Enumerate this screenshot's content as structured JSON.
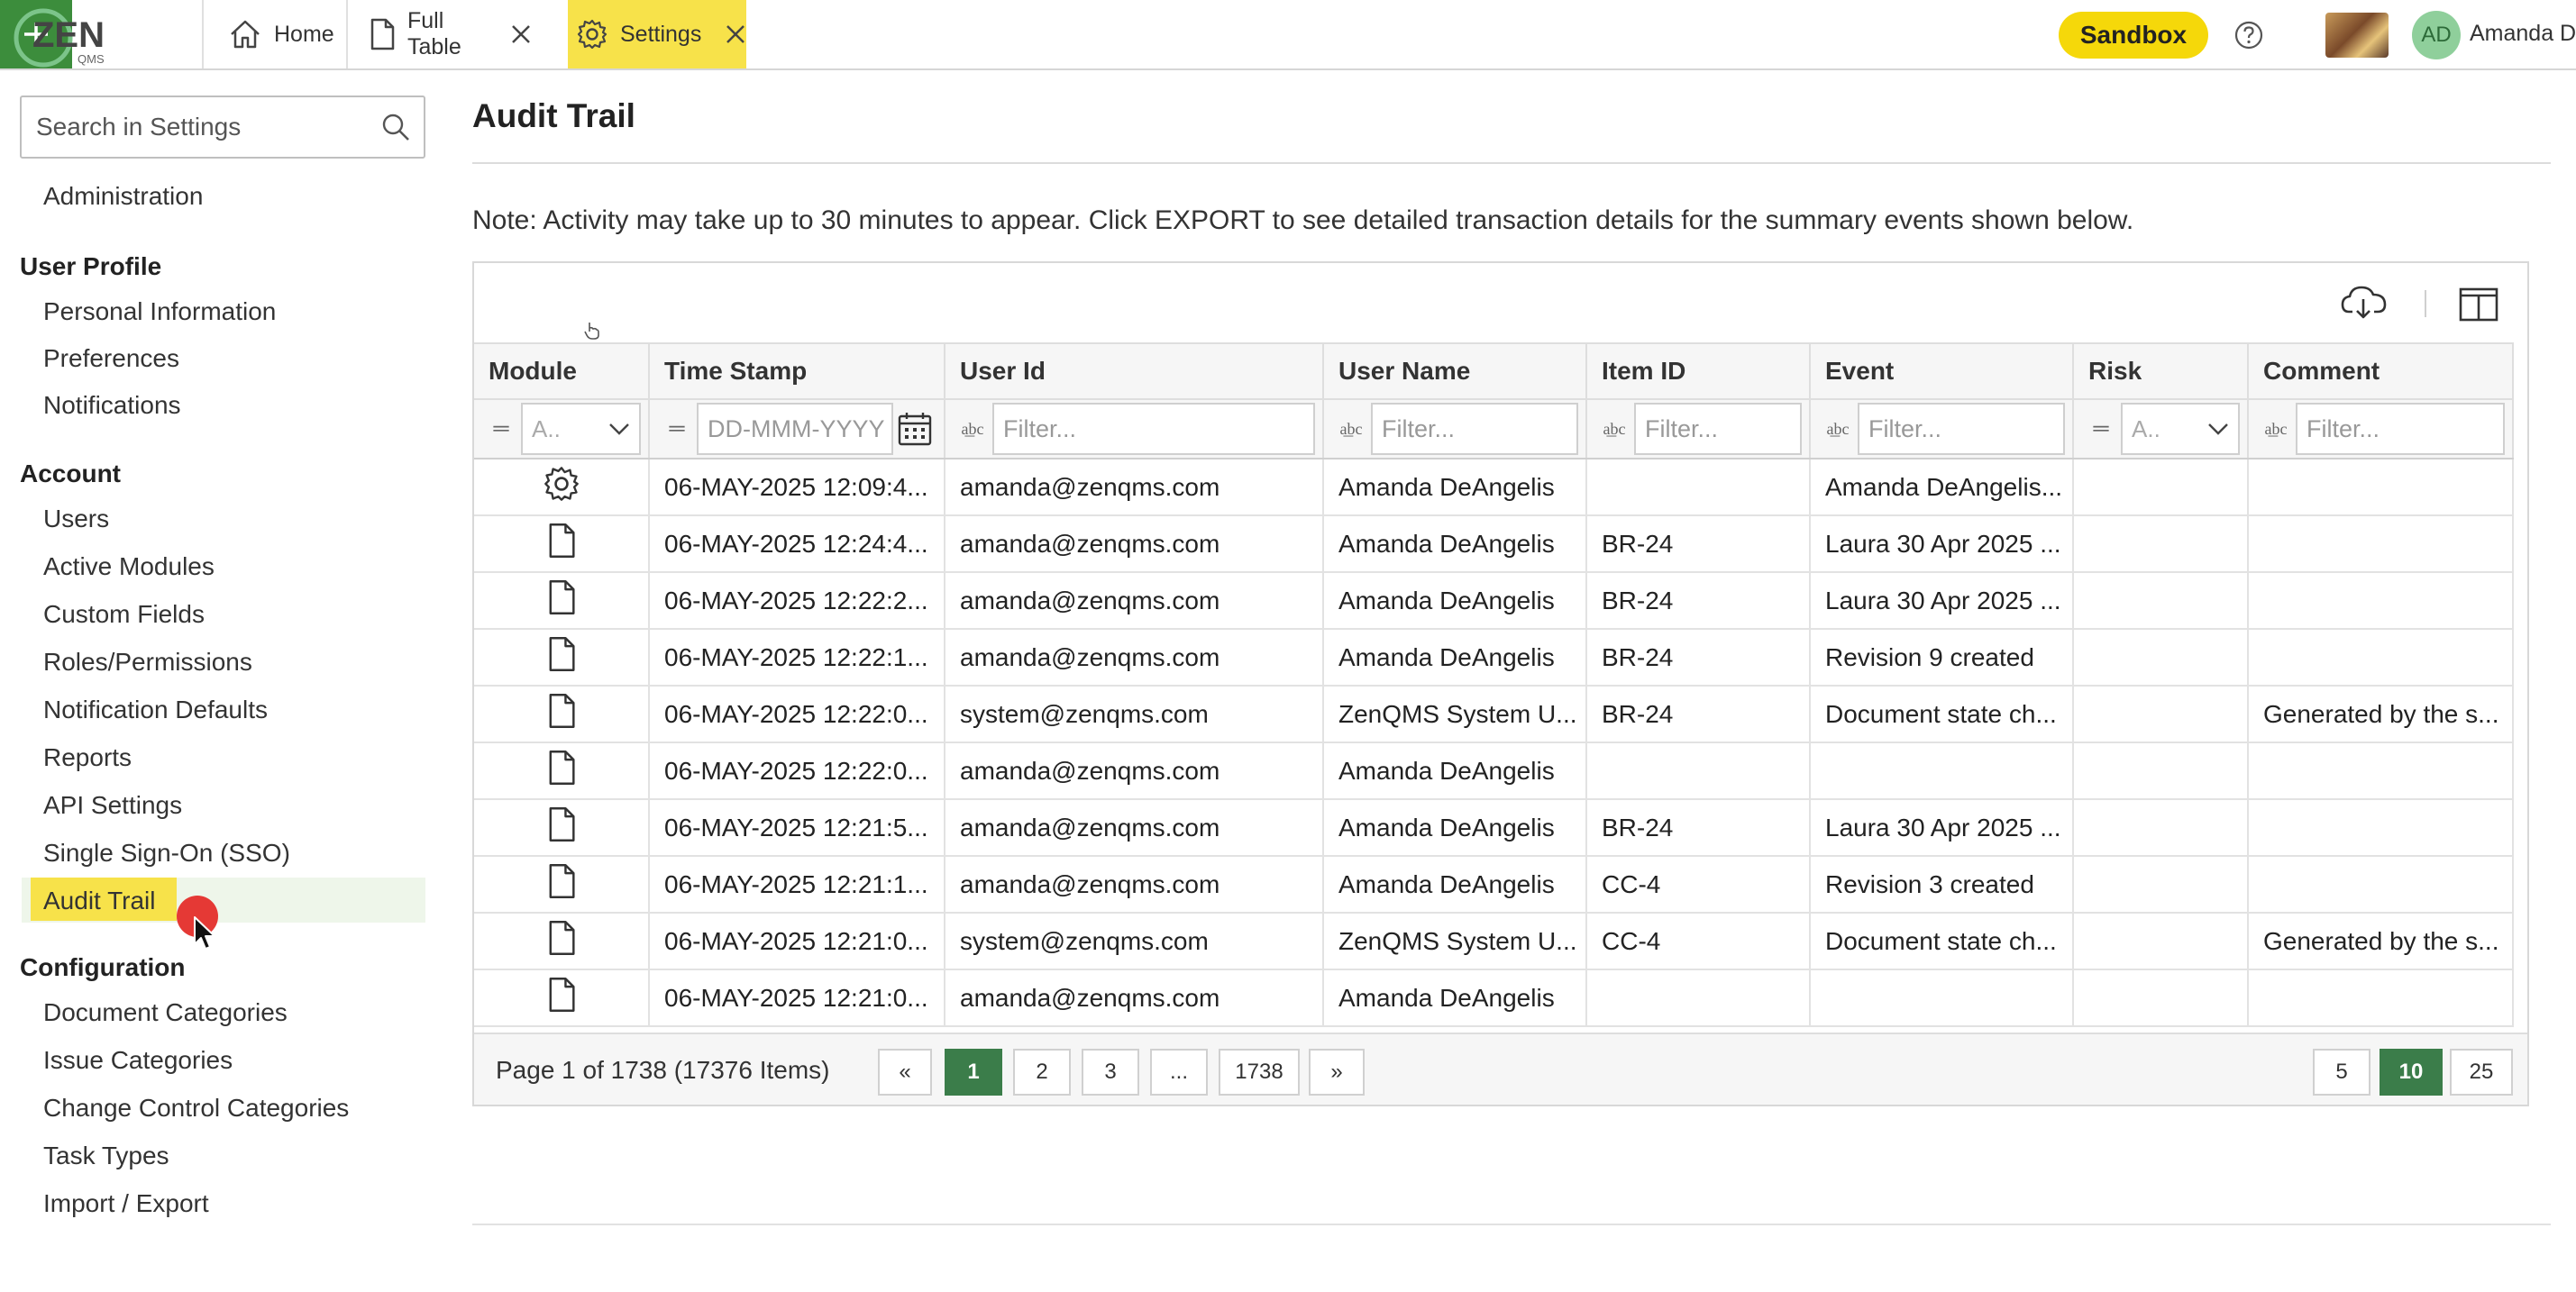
{
  "brand": {
    "logo_text": "ZEN",
    "logo_sub": "QMS"
  },
  "tabs": [
    {
      "label": "Home",
      "icon": "home-icon"
    },
    {
      "label": "Full Table",
      "icon": "document-icon"
    },
    {
      "label": "Settings",
      "icon": "gear-icon",
      "active": true
    }
  ],
  "header": {
    "sandbox_label": "Sandbox",
    "avatar_initials": "AD",
    "user_name": "Amanda D"
  },
  "sidebar": {
    "search_placeholder": "Search in Settings",
    "top_item": "Administration",
    "sections": [
      {
        "title": "User Profile",
        "items": [
          "Personal Information",
          "Preferences",
          "Notifications"
        ]
      },
      {
        "title": "Account",
        "items": [
          "Users",
          "Active Modules",
          "Custom Fields",
          "Roles/Permissions",
          "Notification Defaults",
          "Reports",
          "API Settings",
          "Single Sign-On (SSO)",
          "Audit Trail"
        ]
      },
      {
        "title": "Configuration",
        "items": [
          "Document Categories",
          "Issue Categories",
          "Change Control Categories",
          "Task Types",
          "Import / Export"
        ]
      }
    ],
    "active_item": "Audit Trail"
  },
  "main": {
    "title": "Audit Trail",
    "note": "Note: Activity may take up to 30 minutes to appear. Click EXPORT to see detailed transaction details for the summary events shown below."
  },
  "table": {
    "columns": [
      "Module",
      "Time Stamp",
      "User Id",
      "User Name",
      "Item ID",
      "Event",
      "Risk",
      "Comment"
    ],
    "filters": {
      "module": "A..",
      "timestamp": "DD-MMM-YYYY",
      "user_id": "Filter...",
      "user_name": "Filter...",
      "item_id": "Filter...",
      "event": "Filter...",
      "risk": "A..",
      "comment": "Filter..."
    },
    "rows": [
      {
        "module_icon": "gear-icon",
        "time": "06-MAY-2025 12:09:4...",
        "user_id": "amanda@zenqms.com",
        "user_name": "Amanda DeAngelis",
        "item_id": "",
        "event": "Amanda DeAngelis...",
        "risk": "",
        "comment": ""
      },
      {
        "module_icon": "document-icon",
        "time": "06-MAY-2025 12:24:4...",
        "user_id": "amanda@zenqms.com",
        "user_name": "Amanda DeAngelis",
        "item_id": "BR-24",
        "event": "Laura 30 Apr 2025 ...",
        "risk": "",
        "comment": ""
      },
      {
        "module_icon": "document-icon",
        "time": "06-MAY-2025 12:22:2...",
        "user_id": "amanda@zenqms.com",
        "user_name": "Amanda DeAngelis",
        "item_id": "BR-24",
        "event": "Laura 30 Apr 2025 ...",
        "risk": "",
        "comment": ""
      },
      {
        "module_icon": "document-icon",
        "time": "06-MAY-2025 12:22:1...",
        "user_id": "amanda@zenqms.com",
        "user_name": "Amanda DeAngelis",
        "item_id": "BR-24",
        "event": "Revision 9 created",
        "risk": "",
        "comment": ""
      },
      {
        "module_icon": "document-icon",
        "time": "06-MAY-2025 12:22:0...",
        "user_id": "system@zenqms.com",
        "user_name": "ZenQMS System U...",
        "item_id": "BR-24",
        "event": "Document state ch...",
        "risk": "",
        "comment": "Generated by the s..."
      },
      {
        "module_icon": "document-icon",
        "time": "06-MAY-2025 12:22:0...",
        "user_id": "amanda@zenqms.com",
        "user_name": "Amanda DeAngelis",
        "item_id": "",
        "event": "",
        "risk": "",
        "comment": ""
      },
      {
        "module_icon": "document-icon",
        "time": "06-MAY-2025 12:21:5...",
        "user_id": "amanda@zenqms.com",
        "user_name": "Amanda DeAngelis",
        "item_id": "BR-24",
        "event": "Laura 30 Apr 2025 ...",
        "risk": "",
        "comment": ""
      },
      {
        "module_icon": "document-icon",
        "time": "06-MAY-2025 12:21:1...",
        "user_id": "amanda@zenqms.com",
        "user_name": "Amanda DeAngelis",
        "item_id": "CC-4",
        "event": "Revision 3 created",
        "risk": "",
        "comment": ""
      },
      {
        "module_icon": "document-icon",
        "time": "06-MAY-2025 12:21:0...",
        "user_id": "system@zenqms.com",
        "user_name": "ZenQMS System U...",
        "item_id": "CC-4",
        "event": "Document state ch...",
        "risk": "",
        "comment": "Generated by the s..."
      },
      {
        "module_icon": "document-icon",
        "time": "06-MAY-2025 12:21:0...",
        "user_id": "amanda@zenqms.com",
        "user_name": "Amanda DeAngelis",
        "item_id": "",
        "event": "",
        "risk": "",
        "comment": ""
      }
    ]
  },
  "pager": {
    "info": "Page 1 of 1738 (17376 Items)",
    "first": "«",
    "pages": [
      "1",
      "2",
      "3",
      "...",
      "1738"
    ],
    "last": "»",
    "current_page": "1",
    "page_sizes": [
      "5",
      "10",
      "25"
    ],
    "current_size": "10"
  },
  "colors": {
    "accent_yellow": "#f7e24a",
    "accent_green": "#3b7d4a",
    "add_green": "#3c8d3c",
    "sandbox": "#f5d80a"
  }
}
